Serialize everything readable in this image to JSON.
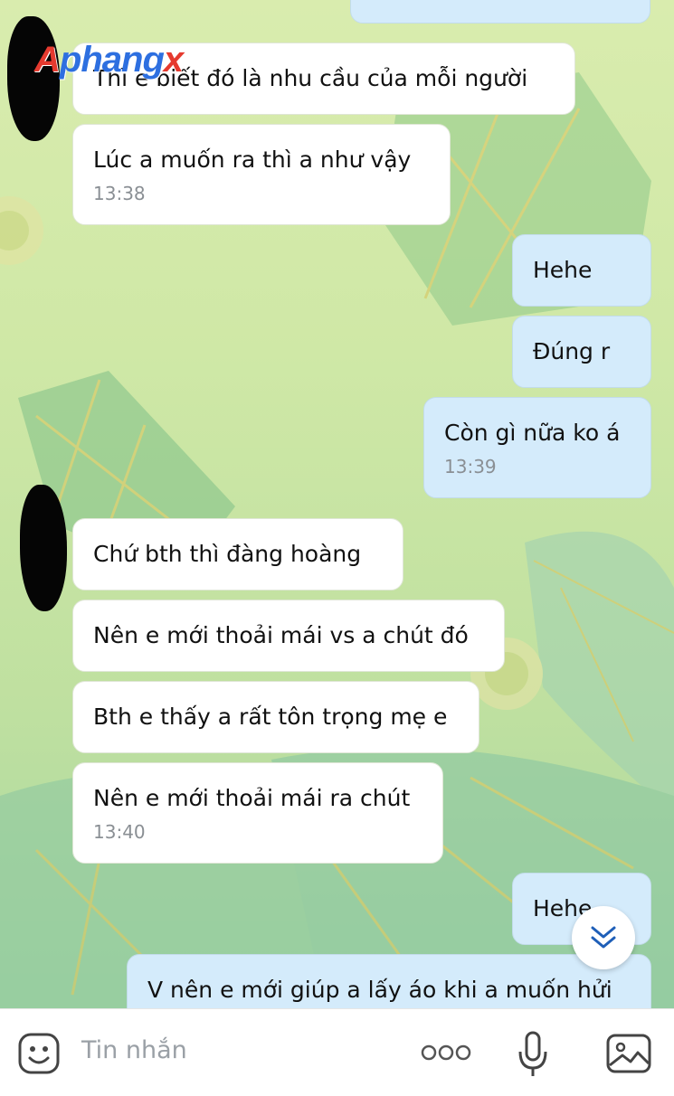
{
  "watermark": {
    "logo_text": "Aphangx"
  },
  "messages": [
    {
      "text": "Thì e biết đó là nhu cầu của mỗi người",
      "time": ""
    },
    {
      "text": "Lúc a muốn ra thì a như vậy",
      "time": "13:38"
    },
    {
      "text": "Hehe",
      "time": ""
    },
    {
      "text": "Đúng r",
      "time": ""
    },
    {
      "text": "Còn gì nữa ko á",
      "time": "13:39"
    },
    {
      "text": "Chứ bth thì đàng hoàng",
      "time": ""
    },
    {
      "text": "Nên e mới thoải mái vs a chút đó",
      "time": ""
    },
    {
      "text": "Bth e thấy a rất tôn trọng mẹ e",
      "time": ""
    },
    {
      "text": "Nên e mới thoải mái ra chút",
      "time": "13:40"
    },
    {
      "text": "Hehe",
      "time": ""
    },
    {
      "text": "V nên e mới giúp a lấy áo khi a muốn hửi",
      "time": ""
    }
  ],
  "composer": {
    "placeholder": "Tin nhắn",
    "icons": [
      "sticker-icon",
      "more-icon",
      "microphone-icon",
      "image-icon"
    ]
  },
  "scroll_button": {
    "icon": "chevron-double-down-icon"
  },
  "colors": {
    "incoming": "#ffffff",
    "outgoing": "#d4ebfb",
    "background": "#cfe8a6"
  }
}
